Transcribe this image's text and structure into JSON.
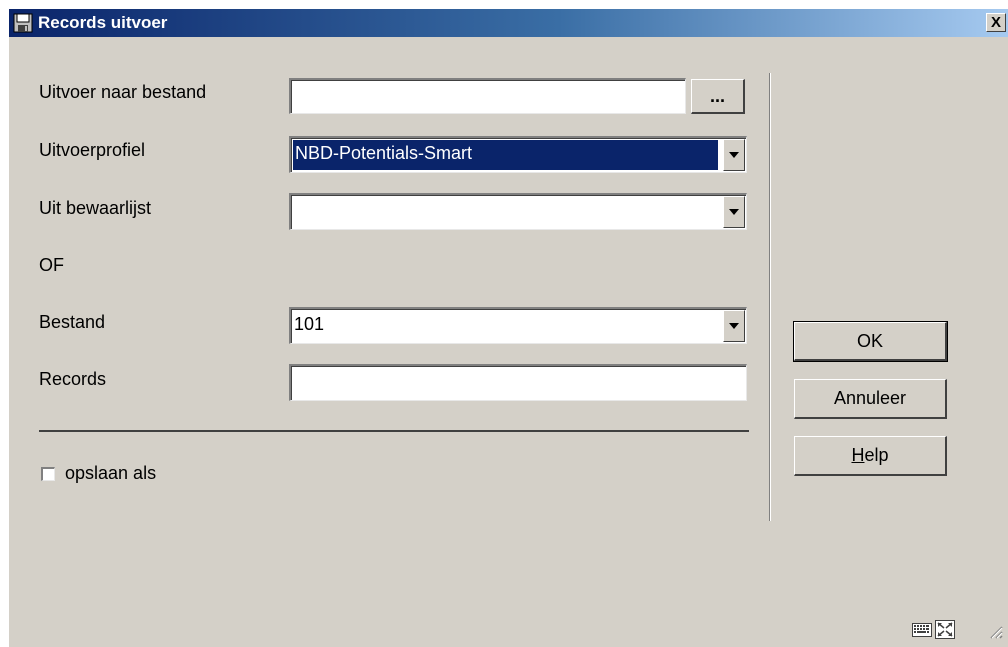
{
  "window": {
    "title": "Records uitvoer",
    "close_glyph": "X"
  },
  "form": {
    "output_file": {
      "label": "Uitvoer naar bestand",
      "value": "",
      "browse_label": "..."
    },
    "output_profile": {
      "label": "Uitvoerprofiel",
      "value": "NBD-Potentials-Smart"
    },
    "from_savelist": {
      "label": "Uit bewaarlijst",
      "value": ""
    },
    "or_label": "OF",
    "database": {
      "label": "Bestand",
      "value": "101"
    },
    "records": {
      "label": "Records",
      "value": ""
    },
    "save_as": {
      "label": "opslaan als",
      "checked": false
    }
  },
  "buttons": {
    "ok": "OK",
    "cancel": "Annuleer",
    "help_prefix": "H",
    "help_rest": "elp"
  },
  "icons": {
    "window_icon": "floppy-disk-icon",
    "keyboard": "keyboard-icon",
    "maximize": "fullscreen-icon",
    "resize": "resize-grip-icon"
  }
}
